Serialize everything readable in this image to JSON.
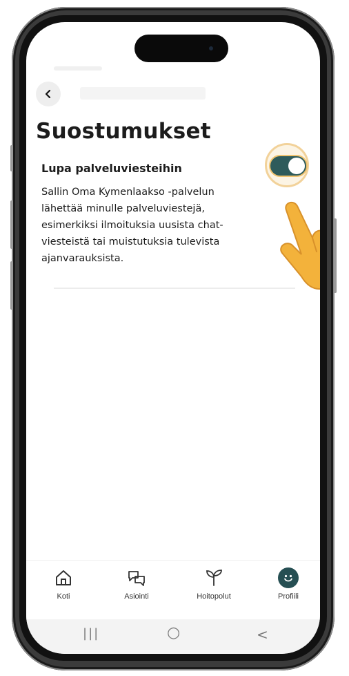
{
  "header": {
    "back_icon": "chevron-left-icon"
  },
  "page": {
    "title": "Suostumukset"
  },
  "consent": {
    "title": "Lupa palveluviesteihin",
    "description": "Sallin Oma Kymenlaakso -palvelun lähettää minulle palveluviestejä, esimerkiksi ilmoituksia uusista chat-viesteistä tai muistutuksia tulevista ajanvarauksista.",
    "toggle_state": "on"
  },
  "nav": {
    "items": [
      {
        "label": "Koti",
        "icon": "home-icon"
      },
      {
        "label": "Asiointi",
        "icon": "chat-bubbles-icon"
      },
      {
        "label": "Hoitopolut",
        "icon": "sprout-icon"
      },
      {
        "label": "Profiili",
        "icon": "smiley-icon",
        "active": true
      }
    ]
  },
  "system_nav": {
    "recents": "|||",
    "home": "○",
    "back": "<"
  },
  "colors": {
    "toggle_on": "#2e5b5b",
    "highlight": "#f0c36f",
    "profile_active": "#264f53"
  }
}
